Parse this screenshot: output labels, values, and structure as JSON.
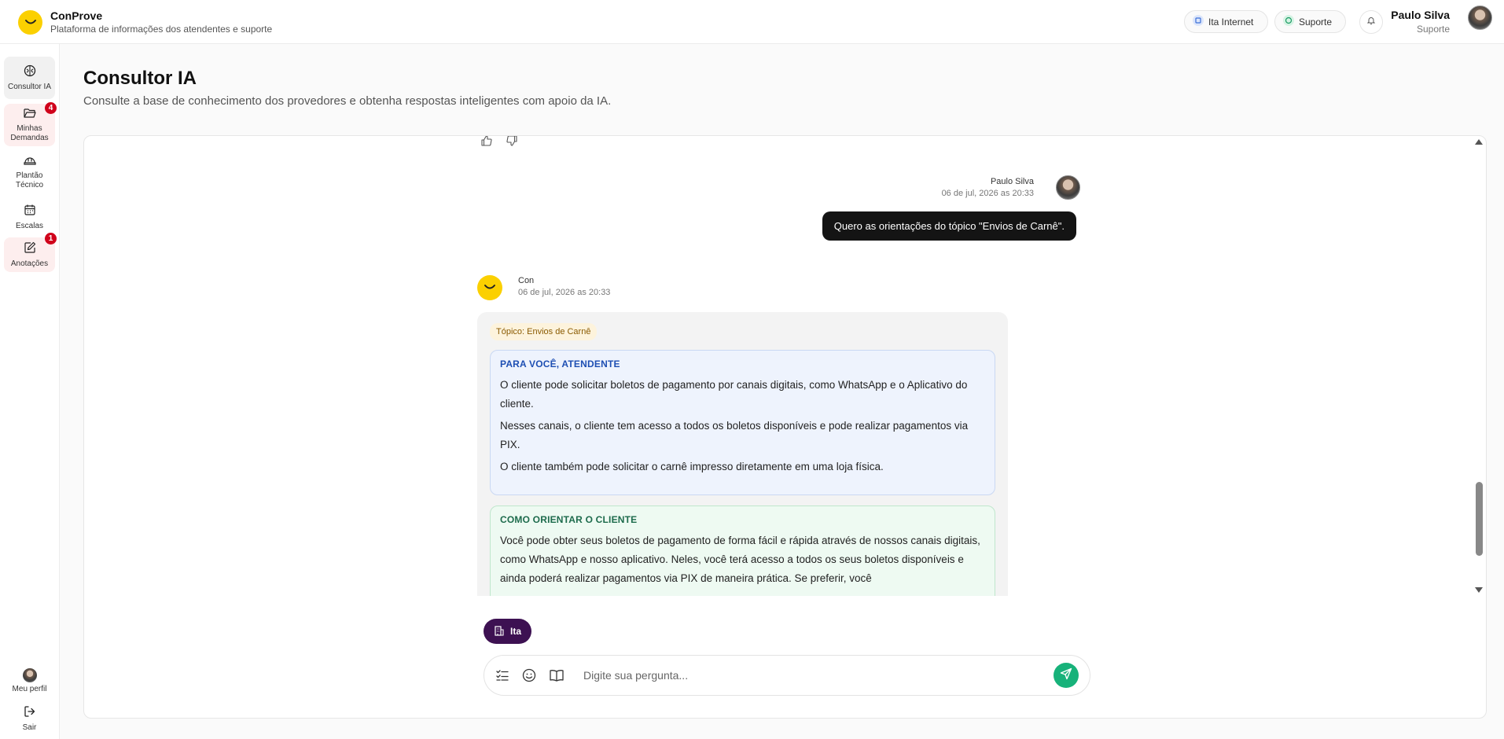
{
  "header": {
    "brand_name": "ConProve",
    "brand_subtitle": "Plataforma de informações dos atendentes e suporte",
    "chip_provider": "Ita Internet",
    "chip_role": "Suporte",
    "user_name": "Paulo Silva",
    "user_role": "Suporte"
  },
  "sidebar": {
    "items": [
      {
        "label": "Consultor IA",
        "icon": "brain-icon"
      },
      {
        "label": "Minhas Demandas",
        "icon": "folder-open-icon",
        "badge": "4"
      },
      {
        "label": "Plantão Técnico",
        "icon": "hard-hat-icon"
      },
      {
        "label": "Escalas",
        "icon": "calendar-icon"
      },
      {
        "label": "Anotações",
        "icon": "notebook-pen-icon",
        "badge": "1"
      }
    ],
    "profile_label": "Meu perfil",
    "logout_label": "Sair"
  },
  "page": {
    "title": "Consultor IA",
    "subtitle": "Consulte a base de conhecimento dos provedores e obtenha respostas inteligentes com apoio da IA."
  },
  "chat": {
    "user_message": {
      "author": "Paulo Silva",
      "time": "06 de jul, 2026 as 20:33",
      "text": "Quero as orientações do tópico \"Envios de Carnê\"."
    },
    "bot_message": {
      "author": "Con",
      "time": "06 de jul, 2026 as 20:33",
      "topic": "Tópico: Envios de Carnê",
      "section1_title": "PARA VOCÊ, ATENDENTE",
      "section1_paragraphs": [
        "O cliente pode solicitar boletos de pagamento por canais digitais, como WhatsApp e o Aplicativo do cliente.",
        "Nesses canais, o cliente tem acesso a todos os boletos disponíveis e pode realizar pagamentos via PIX.",
        "O cliente também pode solicitar o carnê impresso diretamente em uma loja física."
      ],
      "section2_title": "COMO ORIENTAR O CLIENTE",
      "section2_text": "Você pode obter seus boletos de pagamento de forma fácil e rápida através de nossos canais digitais, como WhatsApp e nosso aplicativo. Neles, você terá acesso a todos os seus boletos disponíveis e ainda poderá realizar pagamentos via PIX de maneira prática. Se preferir, você"
    }
  },
  "composer": {
    "provider_tag": "Ita",
    "placeholder": "Digite sua pergunta..."
  },
  "colors": {
    "brand_yellow": "#fbd000",
    "provider_tag_bg": "#3d1152",
    "send_green": "#17b27a",
    "badge_red": "#d0021b"
  }
}
